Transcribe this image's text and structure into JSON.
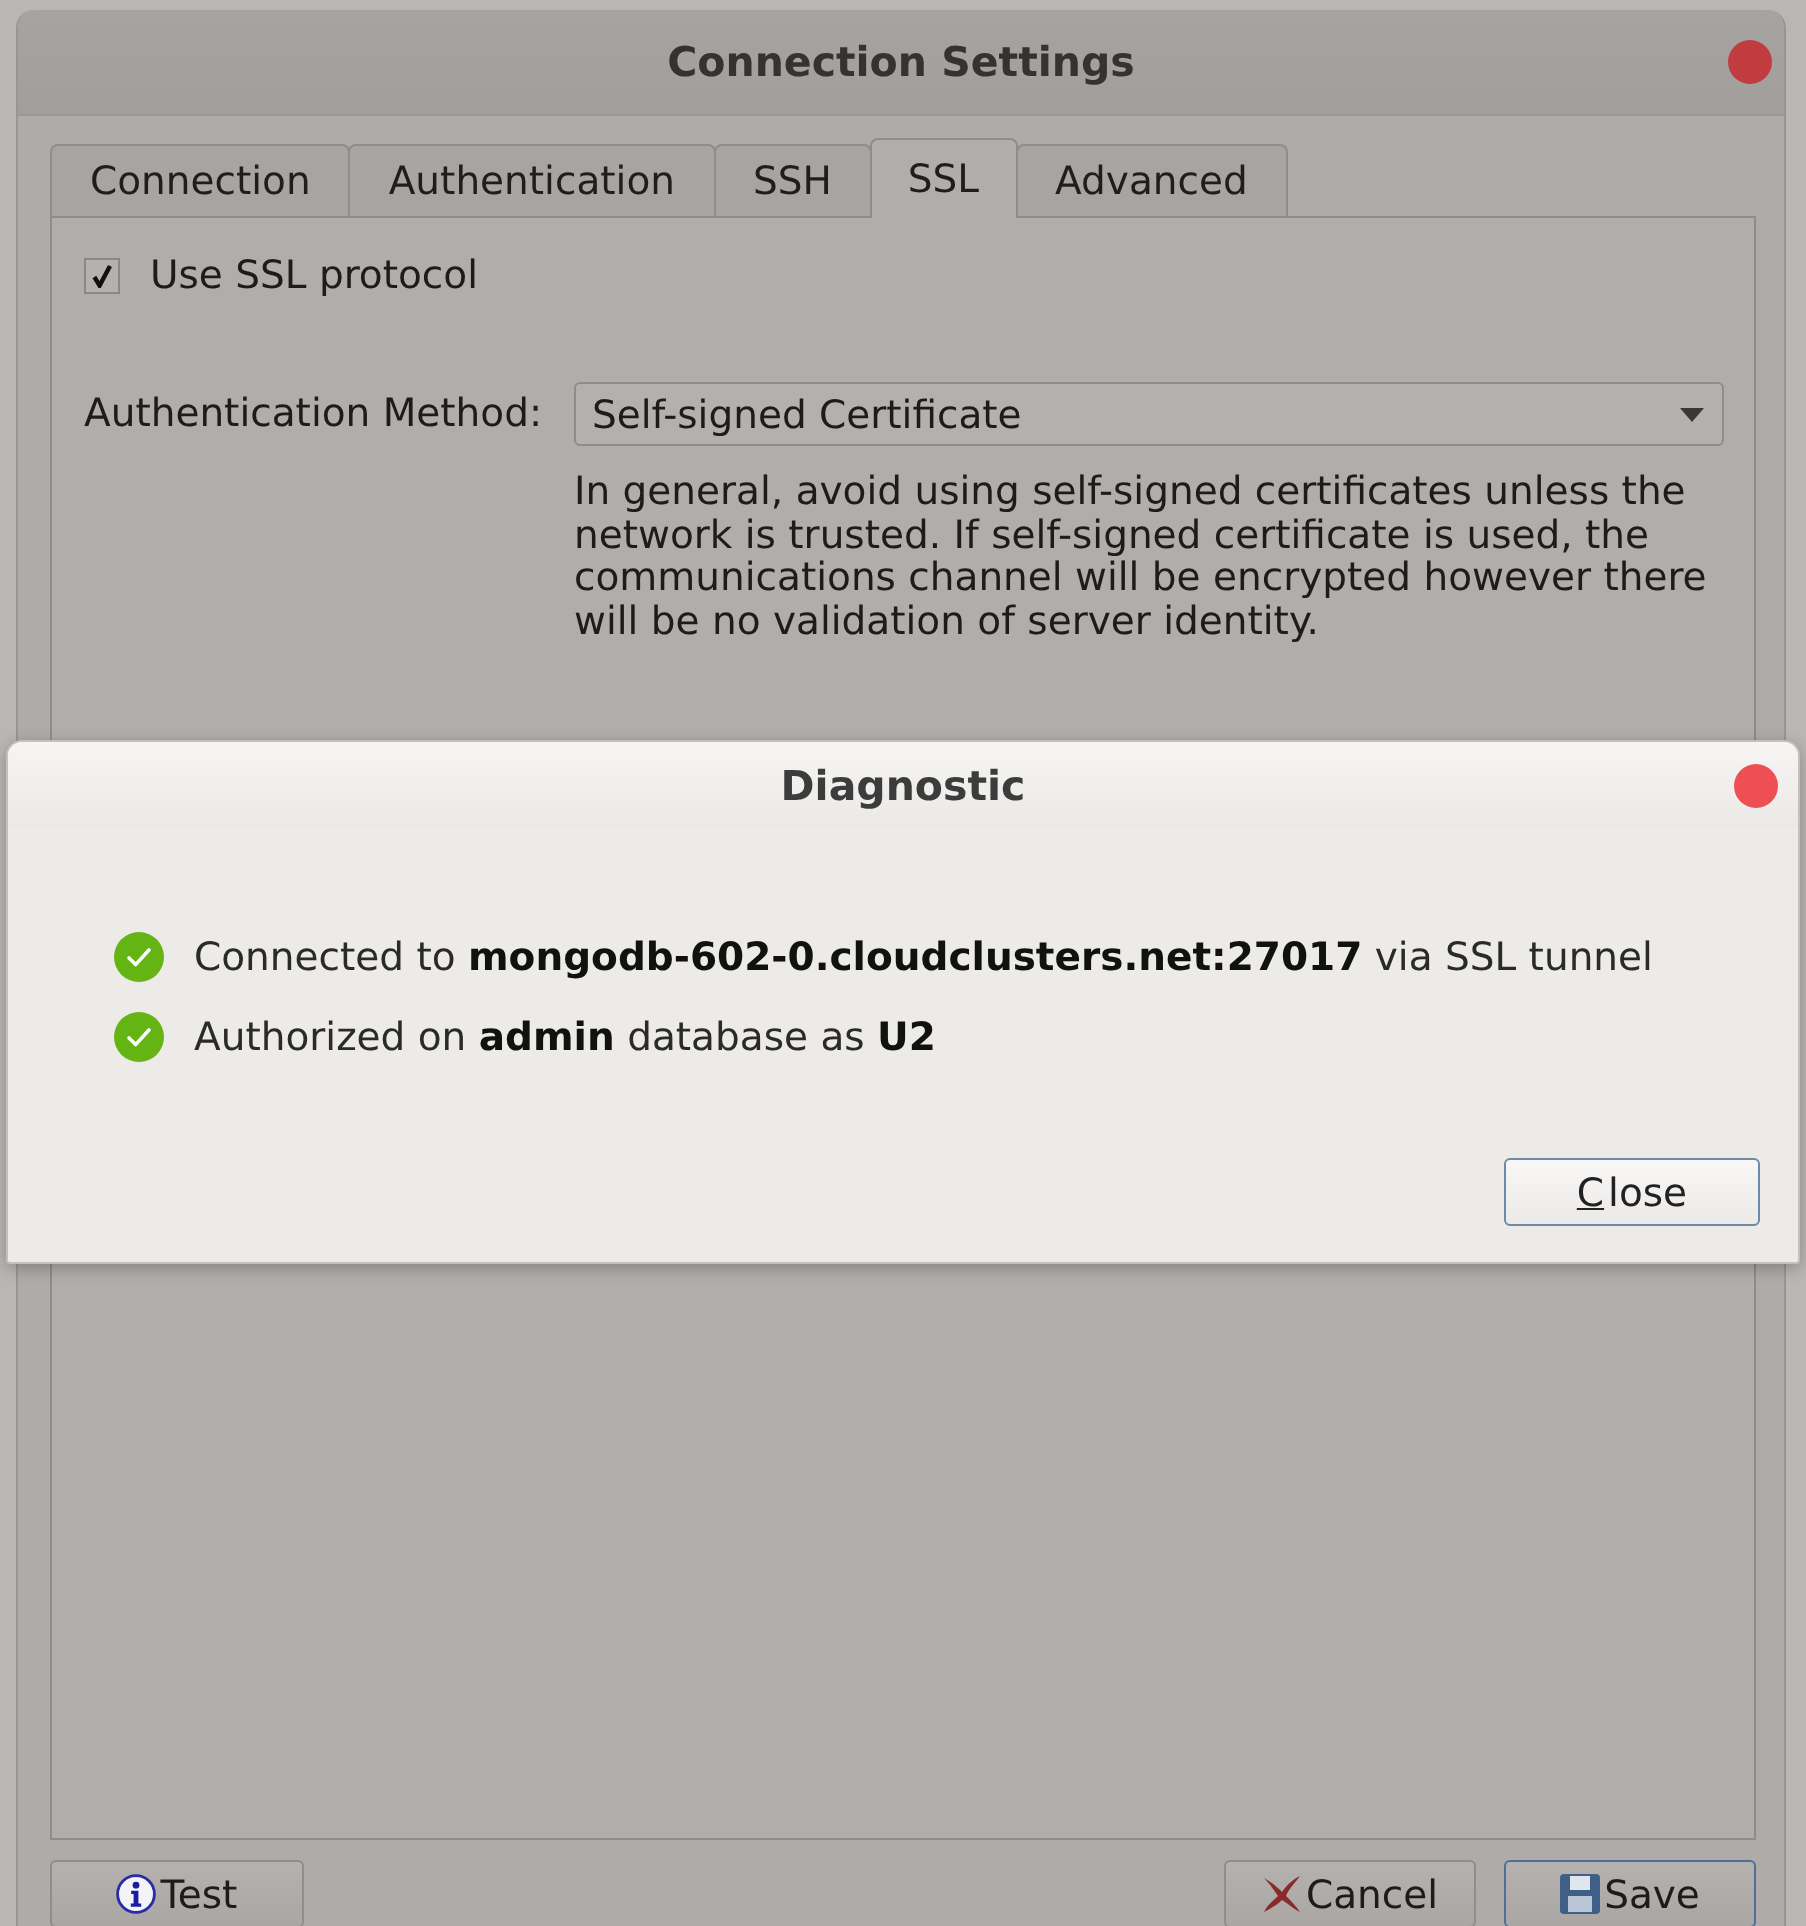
{
  "window": {
    "title": "Connection Settings",
    "inactive": true
  },
  "tabs": [
    {
      "label": "Connection",
      "selected": false
    },
    {
      "label": "Authentication",
      "selected": false
    },
    {
      "label": "SSH",
      "selected": false
    },
    {
      "label": "SSL",
      "selected": true
    },
    {
      "label": "Advanced",
      "selected": false
    }
  ],
  "ssl": {
    "use_ssl": {
      "label": "Use SSL protocol",
      "checked": true
    },
    "auth_method": {
      "label": "Authentication Method:",
      "value": "Self-signed Certificate"
    },
    "help_text": "In general, avoid using self-signed certificates unless the network is trusted. If self-signed certificate is used, the communications channel will be encrypted however there will be no validation of server identity."
  },
  "buttons": [
    {
      "label": "Test",
      "kind": "info",
      "default": false
    },
    {
      "label": "Cancel",
      "kind": "cancel",
      "default": false
    },
    {
      "label": "Save",
      "kind": "save",
      "default": true
    }
  ],
  "dialog": {
    "title": "Diagnostic",
    "messages": [
      {
        "text": "Connected to **mongodb-602-0.cloudclusters.net:27017** via SSL tunnel",
        "kind": "success"
      },
      {
        "text": "Authorized on **admin** database as **U2**",
        "kind": "success"
      }
    ],
    "close_button": {
      "label": "Close",
      "mnemonic_shown": true
    }
  }
}
